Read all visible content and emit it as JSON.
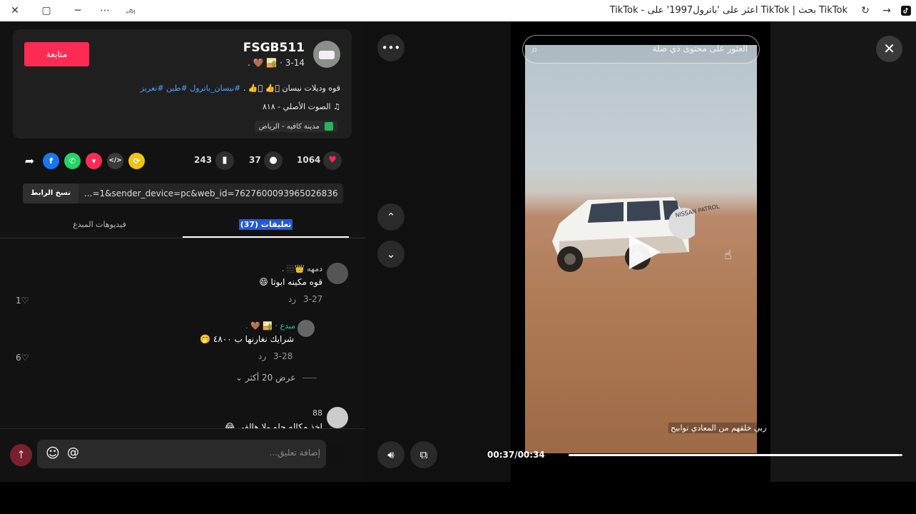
{
  "window": {
    "title": "TikTok بحث | TikTok اعثر على 'باترول1997' على - TikTok"
  },
  "author": {
    "name": "FSGB511",
    "meta": "3-14 · 🏜️ 🤎 .",
    "follow_label": "متابعة"
  },
  "post": {
    "description": "قوه وديلات نيسان 🏼👍 🏼👍 .",
    "hashtags": "#نيسان_باترول #طين #تغريز",
    "music": "الصوت الأصلي - ٨١٨",
    "location": "مدينة كافيه - الرياض"
  },
  "actions": {
    "likes": "1064",
    "comments": "37",
    "saves": "243"
  },
  "link": {
    "copy_label": "نسخ الرابط",
    "url": "...=1&sender_device=pc&web_id=7627600093965026836"
  },
  "tabs": {
    "comments": "(37) تعليقات",
    "creator_videos": "فيديوهات المبدع"
  },
  "comments": [
    {
      "name": "دمهه 👑🏼 .",
      "text": "قوه مكينه ابوتا 😄",
      "date": "3-27",
      "reply": "رد",
      "likes": "1"
    },
    {
      "name": "مبدع · 🏜️ 🤎 .",
      "text": "شرايك نغارنها ب ٤٨٠٠ 🤭",
      "date": "3-28",
      "reply": "رد",
      "likes": "6"
    },
    {
      "name": "88",
      "text": "اخذ مكاله حلو ولا هالفي 😂"
    }
  ],
  "more_replies": "عرض 20 أكثر",
  "input": {
    "placeholder": "إضافة تعليق..."
  },
  "video": {
    "search_placeholder": "العثور على محتوى ذي صلة",
    "caption": "ربي خلقهم من المعادي توابيح",
    "time": "00:37/00:34",
    "progress": 0.99,
    "plate_text": "NISSAN PATROL"
  },
  "icons": {
    "close": "close-icon",
    "more": "more-icon",
    "up": "chevron-up-icon",
    "down": "chevron-down-icon",
    "volume": "volume-icon",
    "play": "play-icon"
  }
}
